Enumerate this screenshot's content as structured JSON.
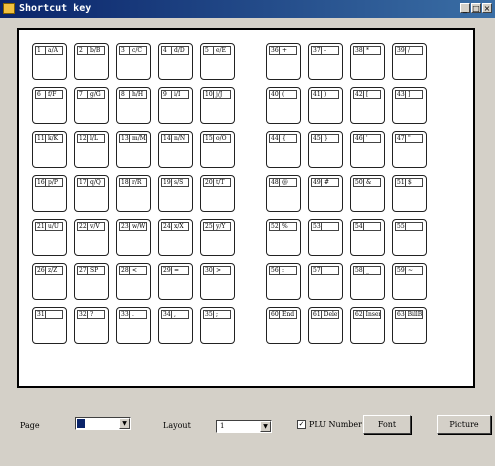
{
  "window": {
    "title": "Shortcut key",
    "buttons": {
      "minimize": "_",
      "maximize": "□",
      "close": "×"
    }
  },
  "keys_left": [
    {
      "n": "1",
      "l": "a/A"
    },
    {
      "n": "2",
      "l": "b/B"
    },
    {
      "n": "3",
      "l": "c/C"
    },
    {
      "n": "4",
      "l": "d/D"
    },
    {
      "n": "5",
      "l": "e/E"
    },
    {
      "n": "6",
      "l": "f/F"
    },
    {
      "n": "7",
      "l": "g/G"
    },
    {
      "n": "8",
      "l": "h/H"
    },
    {
      "n": "9",
      "l": "i/I"
    },
    {
      "n": "10",
      "l": "j/J"
    },
    {
      "n": "11",
      "l": "k/K"
    },
    {
      "n": "12",
      "l": "l/L"
    },
    {
      "n": "13",
      "l": "m/M"
    },
    {
      "n": "14",
      "l": "n/N"
    },
    {
      "n": "15",
      "l": "o/O"
    },
    {
      "n": "16",
      "l": "p/P"
    },
    {
      "n": "17",
      "l": "q/Q"
    },
    {
      "n": "18",
      "l": "r/R"
    },
    {
      "n": "19",
      "l": "s/S"
    },
    {
      "n": "20",
      "l": "t/T"
    },
    {
      "n": "21",
      "l": "u/U"
    },
    {
      "n": "22",
      "l": "v/V"
    },
    {
      "n": "23",
      "l": "w/W"
    },
    {
      "n": "24",
      "l": "x/X"
    },
    {
      "n": "25",
      "l": "y/Y"
    },
    {
      "n": "26",
      "l": "z/Z"
    },
    {
      "n": "27",
      "l": "SP"
    },
    {
      "n": "28",
      "l": "<"
    },
    {
      "n": "29",
      "l": "="
    },
    {
      "n": "30",
      "l": ">"
    },
    {
      "n": "31",
      "l": ""
    },
    {
      "n": "32",
      "l": "?"
    },
    {
      "n": "33",
      "l": "."
    },
    {
      "n": "34",
      "l": ","
    },
    {
      "n": "35",
      "l": ";"
    }
  ],
  "keys_right": [
    {
      "n": "36",
      "l": "+"
    },
    {
      "n": "37",
      "l": "-"
    },
    {
      "n": "38",
      "l": "*"
    },
    {
      "n": "39",
      "l": "/"
    },
    {
      "n": "40",
      "l": "("
    },
    {
      "n": "41",
      "l": ")"
    },
    {
      "n": "42",
      "l": "["
    },
    {
      "n": "43",
      "l": "]"
    },
    {
      "n": "44",
      "l": "{"
    },
    {
      "n": "45",
      "l": "}"
    },
    {
      "n": "46",
      "l": "'"
    },
    {
      "n": "47",
      "l": "\""
    },
    {
      "n": "48",
      "l": "@"
    },
    {
      "n": "49",
      "l": "#"
    },
    {
      "n": "50",
      "l": "&"
    },
    {
      "n": "51",
      "l": "$"
    },
    {
      "n": "52",
      "l": "%"
    },
    {
      "n": "53",
      "l": ""
    },
    {
      "n": "54",
      "l": ""
    },
    {
      "n": "55",
      "l": ""
    },
    {
      "n": "56",
      "l": ":"
    },
    {
      "n": "57",
      "l": ""
    },
    {
      "n": "58",
      "l": "_"
    },
    {
      "n": "59",
      "l": "~"
    },
    {
      "n": "60",
      "l": "End"
    },
    {
      "n": "61",
      "l": "Delete"
    },
    {
      "n": "62",
      "l": "Insert"
    },
    {
      "n": "63",
      "l": "BillB"
    }
  ],
  "bottom": {
    "page_label": "Page",
    "page_value": "1",
    "layout_label": "Layout",
    "layout_value": "1",
    "plu_label": "PLU Number",
    "plu_checked": "✓",
    "font_button": "Font",
    "picture_button": "Picture",
    "dropdown_arrow": "▼"
  }
}
